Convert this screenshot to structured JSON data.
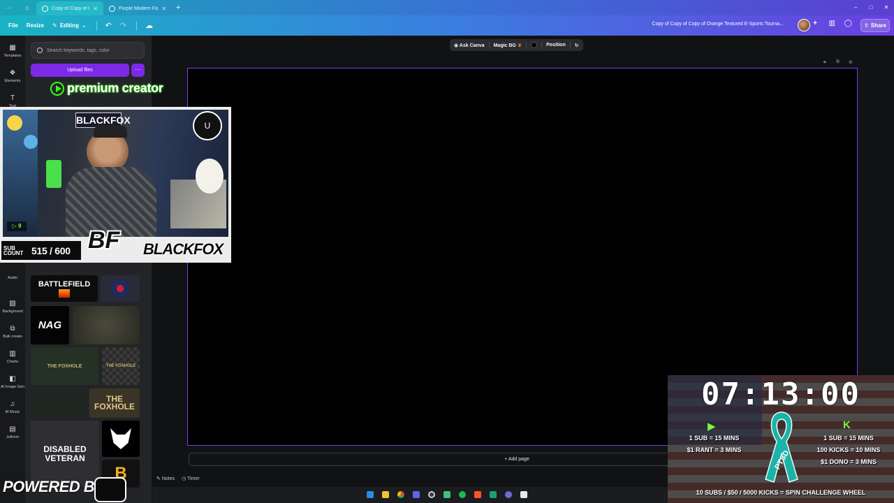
{
  "browser": {
    "tabs": [
      {
        "title": "Copy of Copy of C...",
        "active": true
      },
      {
        "title": "Purple Modern Fan...",
        "active": false
      }
    ],
    "new_tab": "+",
    "window_controls": [
      "–",
      "□",
      "✕"
    ]
  },
  "toolbar": {
    "file_label": "File",
    "resize_label": "Resize",
    "editing_label": "Editing",
    "doc_title": "Copy of Copy of Copy of Orange Textured E-Sports Tourna...",
    "share_label": "Share"
  },
  "sidebar": {
    "items": [
      {
        "label": "Templates",
        "icon": "templates-icon"
      },
      {
        "label": "Elements",
        "icon": "elements-icon"
      },
      {
        "label": "Text",
        "icon": "text-icon"
      },
      {
        "label": "Audio",
        "icon": "audio-icon"
      },
      {
        "label": "Background",
        "icon": "background-icon"
      },
      {
        "label": "Bulk create",
        "icon": "bulk-create-icon"
      },
      {
        "label": "Charts",
        "icon": "charts-icon"
      },
      {
        "label": "AI Image Gen",
        "icon": "ai-image-icon"
      },
      {
        "label": "AI Music",
        "icon": "ai-music-icon"
      },
      {
        "label": "Jotform",
        "icon": "jotform-icon"
      }
    ]
  },
  "panel": {
    "search_placeholder": "Search keywords, tags, color",
    "upload_label": "Upload files",
    "more_label": "···",
    "thumbs": {
      "battlefield": "BATTLEFIELD",
      "nag": "NAG",
      "foxhole_small": "THE FOXHOLE",
      "foxhole": "THE FOXHOLE",
      "disabled": "DISABLED VETERAN"
    }
  },
  "canvas": {
    "ask_canva": "Ask Canva",
    "magic_bg": "Magic BG",
    "position": "Position",
    "add_page": "+ Add page",
    "notes": "Notes",
    "timer": "Timer"
  },
  "overlay": {
    "brand": "premium creator",
    "channel_name": "BLACKFOX",
    "cam_badge": "9",
    "sub_label": "SUB COUNT",
    "sub_count": "515 / 600",
    "logo_word": "BLACKFOX",
    "powered_by": "POWERED BY",
    "timer": "07:13:00",
    "rumble_rates": [
      "1 SUB = 15 MINS",
      "$1 RANT = 3 MINS"
    ],
    "kick_rates": [
      "1 SUB = 15 MINS",
      "100 KICKS = 10 MINS",
      "$1 DONO = 3 MINS"
    ],
    "ribbon_text": "PTSD",
    "spin": "10 SUBS / $50 / 5000 KICKS = SPIN CHALLENGE WHEEL"
  },
  "colors": {
    "accent": "#7d2ae8",
    "page_border": "#7d3cf0",
    "rumble_green": "#73ff3b",
    "ribbon_teal": "#1bb3a8"
  }
}
